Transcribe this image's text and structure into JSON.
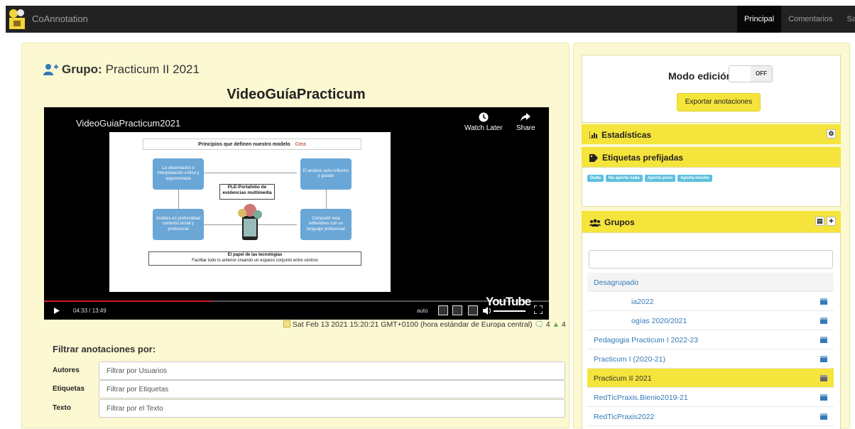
{
  "navbar": {
    "brand": "CoAnnotation",
    "links": [
      {
        "label": "Principal",
        "active": true
      },
      {
        "label": "Comentarios",
        "active": false
      },
      {
        "label": "Salir",
        "active": false
      }
    ]
  },
  "main": {
    "group_prefix": "Grupo:",
    "group_name": "Practicum II 2021",
    "video_title": "VideoGuíaPracticum",
    "player": {
      "title": "VideoGuiaPracticum2021",
      "watch_later": "Watch Later",
      "share": "Share",
      "time": "04:33 / 13:49",
      "quality": "auto",
      "progress": 0.33,
      "logo": "YouTube",
      "slide": {
        "header": "Principios que definen nuestro modelo",
        "header_logo": "Gtea",
        "box_tl": "La observación e interpretación crítica y argumentada",
        "box_tr": "El análisis auto-reflexivo y guiado",
        "box_bl": "Análisis en profundidad contexto social y profesional",
        "box_br": "Compartir esta reflexiones con un lenguaje profesional",
        "center": "PLE-Portafolio de evidencias multimedia",
        "footer_line1": "El papel de las tecnologías",
        "footer_line2": "Facilitar todo lo anterior creando un espacio conjunto entre centros"
      }
    },
    "meta": {
      "date": "Sat Feb 13 2021 15:20:21 GMT+0100 (hora estándar de Europa central)",
      "comments": "4",
      "users": "4"
    },
    "filter": {
      "title": "Filtrar anotaciones por:",
      "rows": [
        {
          "label": "Autores",
          "placeholder": "Filtrar por Usuarios"
        },
        {
          "label": "Etiquetas",
          "placeholder": "Filtrar por Etiquetas"
        },
        {
          "label": "Texto",
          "placeholder": "Filtrar por el Texto"
        }
      ]
    }
  },
  "sidebar": {
    "edit_mode_label": "Modo edición:",
    "edit_toggle": "OFF",
    "export_button": "Exportar anotaciones",
    "stats_title": "Estadísticas",
    "tags_title": "Etiquetas prefijadas",
    "tags": [
      "Duda",
      "No aporta nada",
      "Aporta poco",
      "Aporta mucho"
    ],
    "groups_title": "Grupos",
    "groups": [
      {
        "label": "Desagrupado",
        "icon": false
      },
      {
        "label": "ia2022",
        "icon": true
      },
      {
        "label": "ogías 2020/2021",
        "icon": true
      },
      {
        "label": "Pedagogia Practicum I 2022-23",
        "icon": true
      },
      {
        "label": "Practicum I (2020-21)",
        "icon": true
      },
      {
        "label": "Practicum II 2021",
        "icon": true
      },
      {
        "label": "RedTicPraxis.Bienio2019-21",
        "icon": true
      },
      {
        "label": "RedTicPraxis2022",
        "icon": true
      }
    ]
  },
  "colors": {
    "accent": "#f5e43b",
    "panel_bg": "#fbf8d2",
    "link": "#337ab7",
    "navbar": "#222222"
  }
}
